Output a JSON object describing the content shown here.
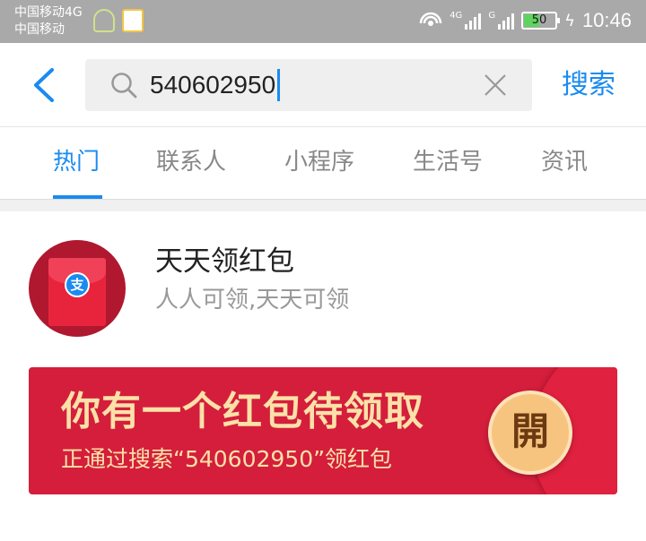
{
  "status_bar": {
    "carrier_line1": "中国移动4G",
    "carrier_line2": "中国移动",
    "sim1_network": "4G",
    "sim2_network": "G",
    "battery_level": "50",
    "time": "10:46"
  },
  "search": {
    "query": "540602950",
    "submit_label": "搜索",
    "accent_color": "#1a8bf0"
  },
  "tabs": [
    {
      "label": "热门",
      "active": true
    },
    {
      "label": "联系人",
      "active": false
    },
    {
      "label": "小程序",
      "active": false
    },
    {
      "label": "生活号",
      "active": false
    },
    {
      "label": "资讯",
      "active": false
    }
  ],
  "result": {
    "title": "天天领红包",
    "subtitle": "人人可领,天天可领",
    "avatar_icon": "red-envelope-icon",
    "avatar_logo_text": "支"
  },
  "banner": {
    "title": "你有一个红包待领取",
    "subtitle": "正通过搜索“540602950”领红包",
    "open_label": "開",
    "background_color": "#d41e3c",
    "text_color": "#fbe1a8"
  }
}
